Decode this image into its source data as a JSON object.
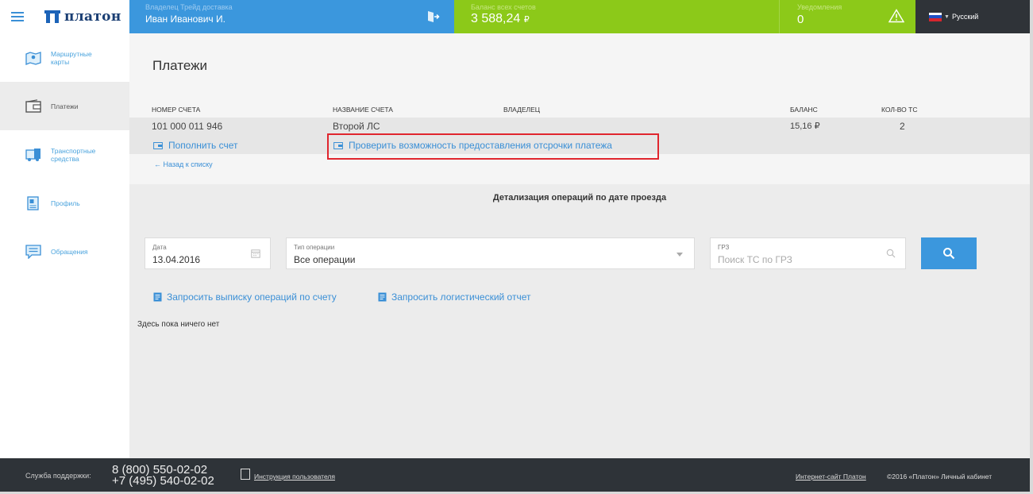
{
  "header": {
    "logo_text": "платон",
    "owner_label": "Владелец Трейд доставка",
    "owner_value": "Иван Иванович И.",
    "balance_label": "Баланс всех счетов",
    "balance_value": "3 588,24",
    "balance_currency": "₽",
    "notifications_label": "Уведомления",
    "notifications_value": "0",
    "language": "Русский"
  },
  "sidebar": {
    "items": [
      {
        "label_line1": "Маршрутные",
        "label_line2": "карты",
        "icon": "map-icon"
      },
      {
        "label_line1": "Платежи",
        "label_line2": "",
        "icon": "wallet-icon"
      },
      {
        "label_line1": "Транспортные",
        "label_line2": "средства",
        "icon": "vehicles-icon"
      },
      {
        "label_line1": "Профиль",
        "label_line2": "",
        "icon": "profile-icon"
      },
      {
        "label_line1": "Обращения",
        "label_line2": "",
        "icon": "message-icon"
      }
    ]
  },
  "main": {
    "title": "Платежи",
    "columns": [
      "Номер счета",
      "Название счета",
      "Владелец",
      "Баланс",
      "Кол-во ТС"
    ],
    "row": {
      "number": "101 000 011 946",
      "name": "Второй ЛС",
      "owner": "",
      "balance": "15,16 ₽",
      "vehicles": "2"
    },
    "topup_link": "Пополнить счет",
    "deferral_link": "Проверить возможность предоставления отсрочки платежа",
    "back_link": "← Назад к списку",
    "section_title": "Детализация операций по дате проезда",
    "filters": {
      "date_label": "Дата",
      "date_value": "13.04.2016",
      "type_label": "Тип операции",
      "type_value": "Все операции",
      "grz_label": "ГРЗ",
      "grz_placeholder": "Поиск ТС по ГРЗ"
    },
    "statement_link": "Запросить выписку операций по счету",
    "logistic_link": "Запросить логистический отчет",
    "empty_text": "Здесь пока ничего нет"
  },
  "footer": {
    "support_label": "Служба поддержки:",
    "phone1": "8 (800) 550-02-02",
    "phone2": "+7 (495) 540-02-02",
    "manual_link": "Инструкция пользователя",
    "site_link": "Интернет-сайт Платон",
    "copyright": "©2016 «Платон» Личный кабинет"
  },
  "colors": {
    "accent_blue": "#3b97dd",
    "accent_green": "#8cc919",
    "dark": "#2e3338",
    "highlight_red": "#e0262e"
  }
}
